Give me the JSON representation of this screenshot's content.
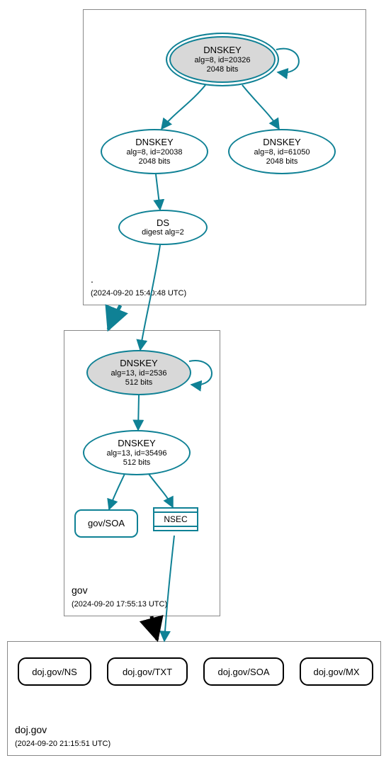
{
  "zones": {
    "root": {
      "name": ".",
      "timestamp": "(2024-09-20 15:40:48 UTC)",
      "nodes": {
        "ksk": {
          "title": "DNSKEY",
          "sub1": "alg=8, id=20326",
          "sub2": "2048 bits"
        },
        "zsk": {
          "title": "DNSKEY",
          "sub1": "alg=8, id=20038",
          "sub2": "2048 bits"
        },
        "zsk2": {
          "title": "DNSKEY",
          "sub1": "alg=8, id=61050",
          "sub2": "2048 bits"
        },
        "ds": {
          "title": "DS",
          "sub1": "digest alg=2"
        }
      }
    },
    "gov": {
      "name": "gov",
      "timestamp": "(2024-09-20 17:55:13 UTC)",
      "nodes": {
        "ksk": {
          "title": "DNSKEY",
          "sub1": "alg=13, id=2536",
          "sub2": "512 bits"
        },
        "zsk": {
          "title": "DNSKEY",
          "sub1": "alg=13, id=35496",
          "sub2": "512 bits"
        },
        "soa": {
          "label": "gov/SOA"
        },
        "nsec": {
          "label": "NSEC"
        }
      }
    },
    "dojgov": {
      "name": "doj.gov",
      "timestamp": "(2024-09-20 21:15:51 UTC)",
      "records": {
        "ns": "doj.gov/NS",
        "txt": "doj.gov/TXT",
        "soa": "doj.gov/SOA",
        "mx": "doj.gov/MX"
      }
    }
  }
}
